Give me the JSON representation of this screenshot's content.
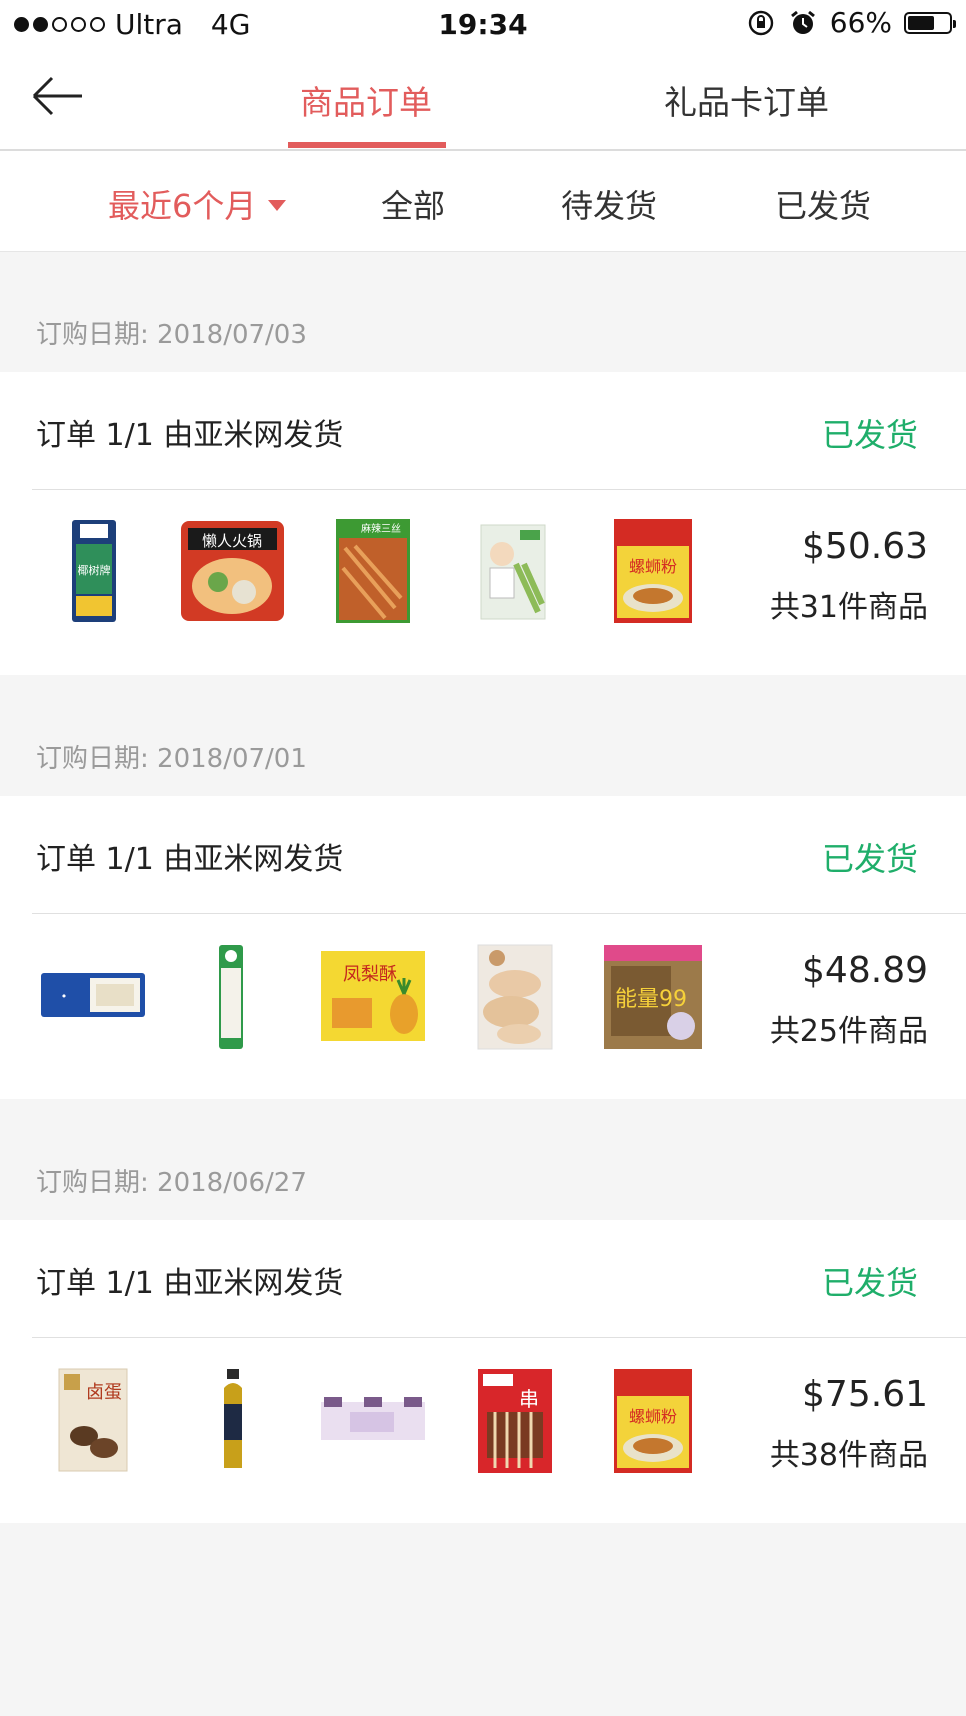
{
  "status_bar": {
    "carrier": "Ultra",
    "network": "4G",
    "time": "19:34",
    "battery": "66%",
    "battery_level": 0.66
  },
  "header": {
    "back_icon": "arrow-left-icon",
    "tabs": [
      {
        "label": "商品订单",
        "active": true
      },
      {
        "label": "礼品卡订单",
        "active": false
      }
    ]
  },
  "filters": {
    "period": "最近6个月",
    "all": "全部",
    "pending": "待发货",
    "shipped": "已发货"
  },
  "colors": {
    "accent": "#e25c5c",
    "status_green": "#1fae6a",
    "background": "#f5f5f5"
  },
  "orders": [
    {
      "date_label": "订购日期: 2018/07/03",
      "title": "订单 1/1 由亚米网发货",
      "status": "已发货",
      "price": "$50.63",
      "count": "共31件商品",
      "items": [
        {
          "name": "椰树牌 coconut juice carton",
          "label": "椰树牌"
        },
        {
          "name": "懒人火锅 self-heating hot pot",
          "label": "懒人火锅"
        },
        {
          "name": "麻辣三丝 spicy snack pack",
          "label": "麻辣三丝"
        },
        {
          "name": "豆干 snack bag",
          "label": ""
        },
        {
          "name": "螺蛳粉 rice noodle pack",
          "label": "螺蛳粉"
        }
      ]
    },
    {
      "date_label": "订购日期: 2018/07/01",
      "title": "订单 1/1 由亚米网发货",
      "status": "已发货",
      "price": "$48.89",
      "count": "共25件商品",
      "items": [
        {
          "name": "Korean cream wafer bar",
          "label": ""
        },
        {
          "name": "Potato Cracker stick pack",
          "label": "Potato Cracker"
        },
        {
          "name": "凤梨酥 Pineapple Cake box",
          "label": "凤梨酥"
        },
        {
          "name": "shredded snack bag",
          "label": ""
        },
        {
          "name": "能量99 cereal rolls pack",
          "label": "能量99"
        }
      ]
    },
    {
      "date_label": "订购日期: 2018/06/27",
      "title": "订单 1/1 由亚米网发货",
      "status": "已发货",
      "price": "$75.61",
      "count": "共38件商品",
      "items": [
        {
          "name": "卤蛋 braised egg pack",
          "label": "卤蛋"
        },
        {
          "name": "green tea bottle",
          "label": ""
        },
        {
          "name": "yogurt drink 3-pack",
          "label": ""
        },
        {
          "name": "串 snack bag",
          "label": "串"
        },
        {
          "name": "螺蛳粉 rice noodle pack",
          "label": "螺蛳粉"
        }
      ]
    }
  ]
}
